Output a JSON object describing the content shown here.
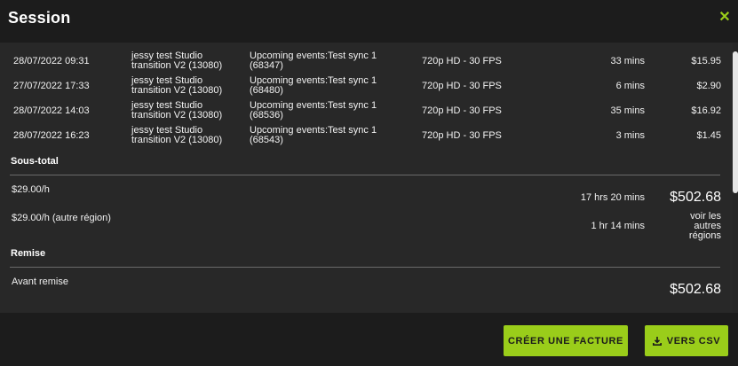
{
  "header": {
    "title": "Session",
    "close_label": "✕"
  },
  "rows": [
    {
      "date": "28/07/2022 09:31",
      "studio": "jessy test Studio transition V2 (13080)",
      "event": "Upcoming events:Test sync 1 (68347)",
      "resolution": "720p HD - 30 FPS",
      "duration": "33 mins",
      "price": "$15.95"
    },
    {
      "date": "27/07/2022 17:33",
      "studio": "jessy test Studio transition V2 (13080)",
      "event": "Upcoming events:Test sync 1 (68480)",
      "resolution": "720p HD - 30 FPS",
      "duration": "6 mins",
      "price": "$2.90"
    },
    {
      "date": "28/07/2022 14:03",
      "studio": "jessy test Studio transition V2 (13080)",
      "event": "Upcoming events:Test sync 1 (68536)",
      "resolution": "720p HD - 30 FPS",
      "duration": "35 mins",
      "price": "$16.92"
    },
    {
      "date": "28/07/2022 16:23",
      "studio": "jessy test Studio transition V2 (13080)",
      "event": "Upcoming events:Test sync 1 (68543)",
      "resolution": "720p HD - 30 FPS",
      "duration": "3 mins",
      "price": "$1.45"
    }
  ],
  "subtotal": {
    "title": "Sous-total",
    "rate_label": "$29.00/h",
    "rate_duration": "17 hrs 20 mins",
    "rate_amount": "$502.68",
    "other_rate_label": "$29.00/h (autre région)",
    "other_rate_duration": "1 hr 14 mins",
    "other_regions_link": "voir les autres régions"
  },
  "discount": {
    "title": "Remise",
    "before_label": "Avant remise",
    "before_amount": "$502.68"
  },
  "footer": {
    "invoice_button": "CRÉER UNE FACTURE",
    "csv_button": "VERS CSV"
  },
  "colors": {
    "accent": "#9acd1a",
    "background": "#1c1c1c",
    "panel": "#282828"
  }
}
